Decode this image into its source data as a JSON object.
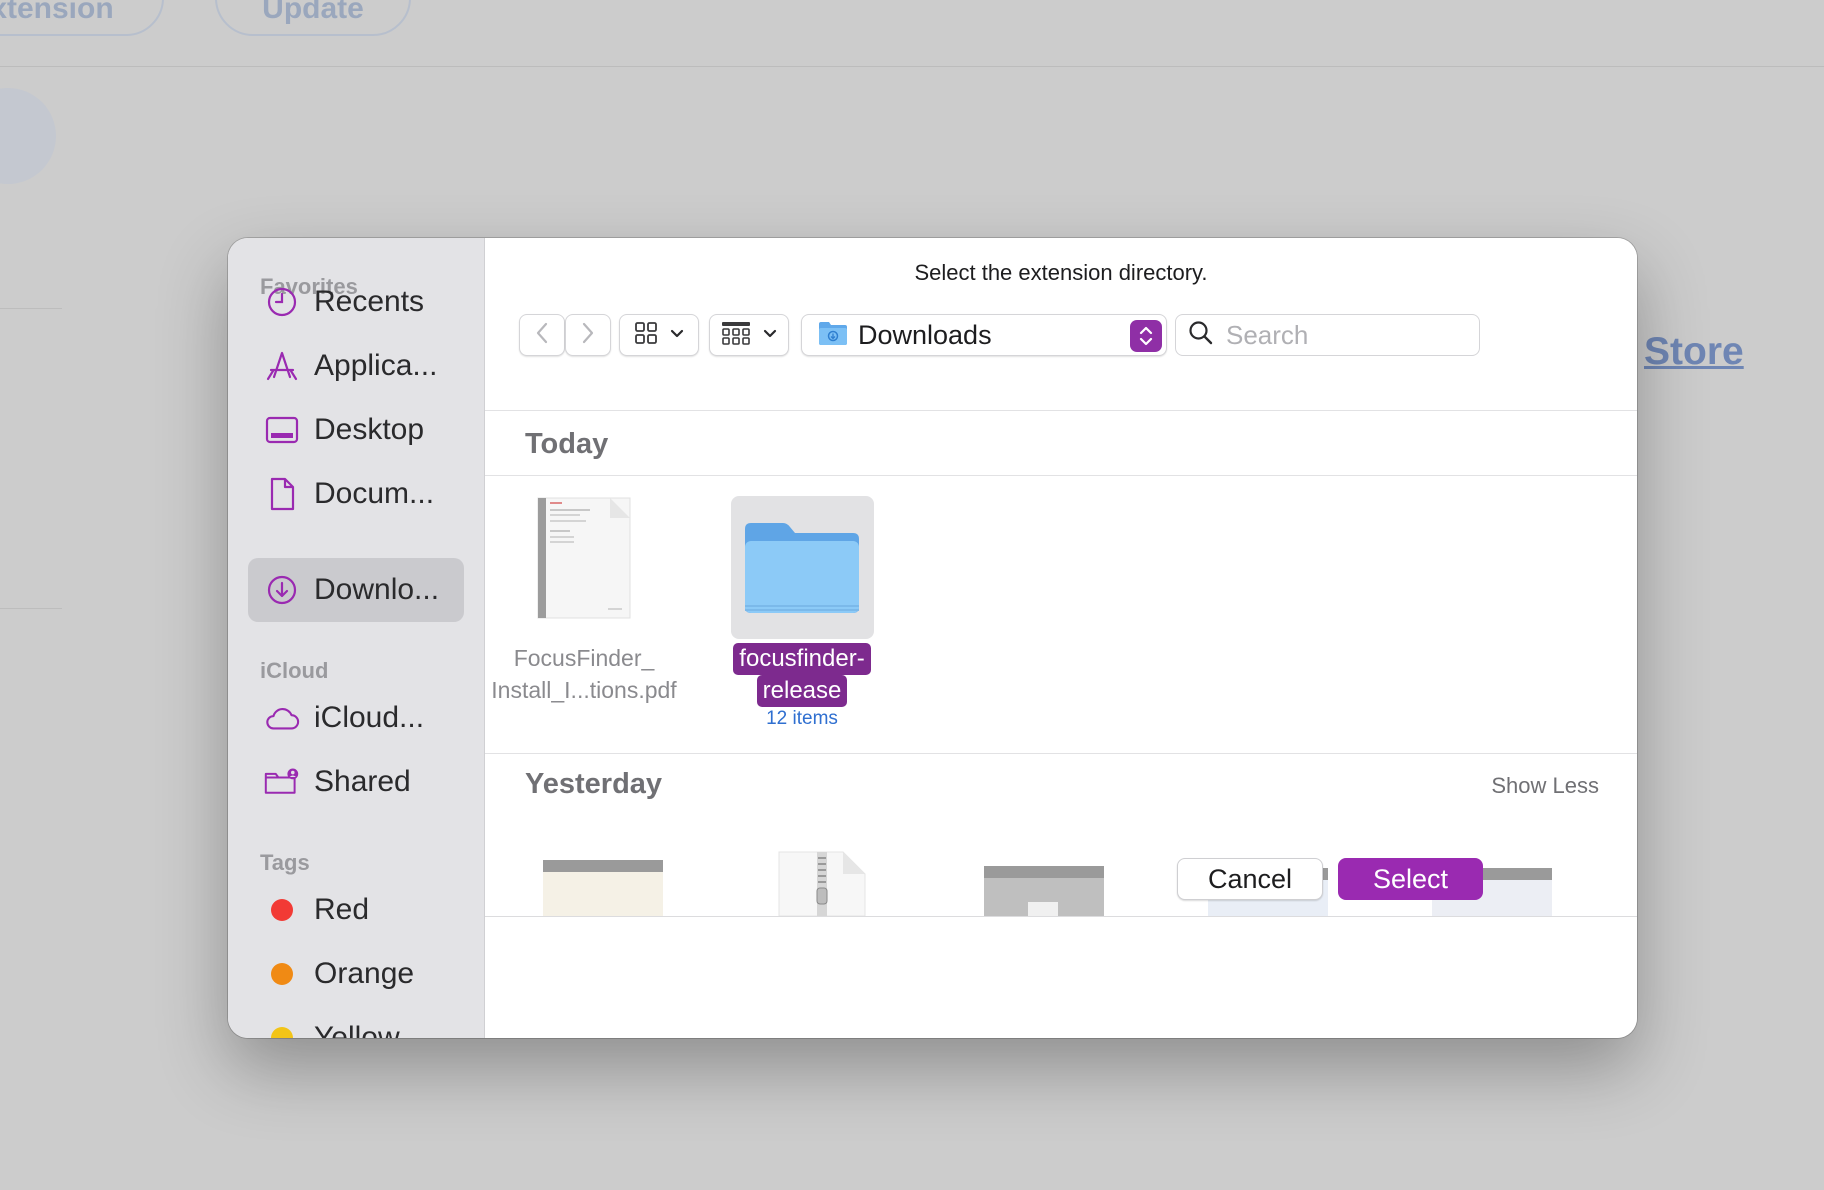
{
  "background": {
    "store_link": "Store"
  },
  "dialog": {
    "prompt": "Select the extension directory.",
    "sidebar": {
      "favorites_header": "Favorites",
      "favorites": [
        {
          "label": "Recents",
          "icon": "clock-icon"
        },
        {
          "label": "Applica...",
          "icon": "applications-icon"
        },
        {
          "label": "Desktop",
          "icon": "desktop-icon"
        },
        {
          "label": "Docum...",
          "icon": "document-icon"
        },
        {
          "label": "Downlo...",
          "icon": "download-icon",
          "selected": true
        }
      ],
      "icloud_header": "iCloud",
      "icloud": [
        {
          "label": "iCloud...",
          "icon": "cloud-icon"
        },
        {
          "label": "Shared",
          "icon": "shared-folder-icon"
        }
      ],
      "tags_header": "Tags",
      "tags": [
        {
          "label": "Red",
          "color": "#f23a35"
        },
        {
          "label": "Orange",
          "color": "#f08a14"
        },
        {
          "label": "Yellow",
          "color": "#f2c417"
        }
      ]
    },
    "toolbar": {
      "location": "Downloads",
      "search_placeholder": "Search"
    },
    "groups": {
      "today": "Today",
      "yesterday": "Yesterday",
      "show_less": "Show Less"
    },
    "files": {
      "pdf_line1": "FocusFinder_",
      "pdf_line2": "Install_I...tions.pdf",
      "folder_line1": "focusfinder-",
      "folder_line2": "release",
      "folder_count": "12 items"
    },
    "buttons": {
      "cancel": "Cancel",
      "select": "Select"
    },
    "accent_color": "#9a2ab1"
  }
}
